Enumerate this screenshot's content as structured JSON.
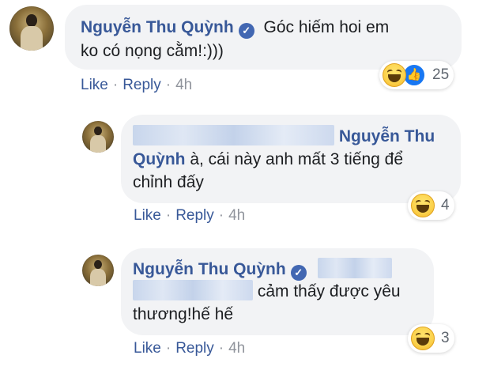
{
  "comments": [
    {
      "author": "Nguyễn Thu Quỳnh",
      "text_line1": "Góc hiếm hoi em",
      "text_line2": "ko có nọng cằm!:)))",
      "actions": {
        "like": "Like",
        "reply": "Reply",
        "time": "4h",
        "sep": "·"
      },
      "reaction_count": "25",
      "reactions": [
        "haha-icon",
        "like-icon"
      ]
    },
    {
      "mention": "Nguyễn Thu",
      "text_line2": "Quỳnh à, cái này anh mất 3 tiếng để",
      "text_line3": "chỉnh đấy",
      "actions": {
        "like": "Like",
        "reply": "Reply",
        "time": "4h",
        "sep": "·"
      },
      "reaction_count": "4",
      "reactions": [
        "haha-icon"
      ]
    },
    {
      "author": "Nguyễn Thu Quỳnh",
      "text_line2": "cảm thấy được yêu",
      "text_line3": "thương!hế hế",
      "actions": {
        "like": "Like",
        "reply": "Reply",
        "time": "4h",
        "sep": "·"
      },
      "reaction_count": "3",
      "reactions": [
        "haha-icon"
      ]
    }
  ],
  "colors": {
    "link": "#385898",
    "bubble": "#f2f3f5",
    "verified": "#4267b2"
  }
}
